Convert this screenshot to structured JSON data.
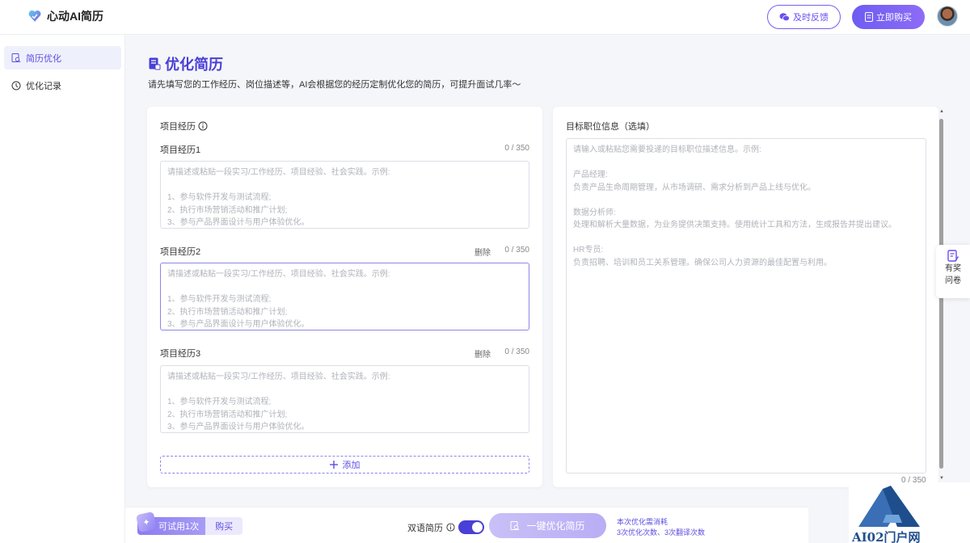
{
  "header": {
    "app_name": "心动AI简历",
    "feedback_label": "及时反馈",
    "buy_label": "立即购买"
  },
  "sidebar": {
    "items": [
      {
        "label": "简历优化",
        "icon": "resume-search-icon",
        "active": true
      },
      {
        "label": "优化记录",
        "icon": "history-icon",
        "active": false
      }
    ]
  },
  "main": {
    "title": "优化简历",
    "subtitle": "请先填写您的工作经历、岗位描述等，AI会根据您的经历定制优化您的简历，可提升面试几率～"
  },
  "projects": {
    "section_title": "项目经历",
    "delete_label": "删除",
    "add_label": "添加",
    "placeholder": "请描述或粘贴一段实习/工作经历、项目经验、社会实践。示例:\n\n1、参与软件开发与测试流程;\n2、执行市场营销活动和推广计划;\n3、参与产品界面设计与用户体验优化。",
    "items": [
      {
        "label": "项目经历1",
        "count": "0 / 350"
      },
      {
        "label": "项目经历2",
        "count": "0 / 350"
      },
      {
        "label": "项目经历3",
        "count": "0 / 350"
      }
    ]
  },
  "target": {
    "title": "目标职位信息（选填）",
    "placeholder": "请输入或粘贴您需要投递的目标职位描述信息。示例:\n\n产品经理:\n负责产品生命周期管理，从市场调研、需求分析到产品上线与优化。\n\n数据分析师:\n处理和解析大量数据，为业务提供决策支持。使用统计工具和方法，生成报告并提出建议。\n\nHR专员:\n负责招聘、培训和员工关系管理。确保公司人力资源的最佳配置与利用。",
    "count": "0 / 350"
  },
  "survey": {
    "line1": "有奖",
    "line2": "问卷"
  },
  "footer": {
    "trial_label": "可试用1次",
    "buy_label": "购买",
    "bilingual_label": "双语简历",
    "bilingual_on": true,
    "optimize_label": "一键优化简历",
    "cost_line1": "本次优化需消耗",
    "cost_line2": "3次优化次数、3次翻译次数"
  },
  "watermark": "AI02门户网",
  "colors": {
    "accent": "#5b4ee0",
    "button_gradient_start": "#6d5cf3",
    "button_gradient_end": "#8d6cf6"
  }
}
